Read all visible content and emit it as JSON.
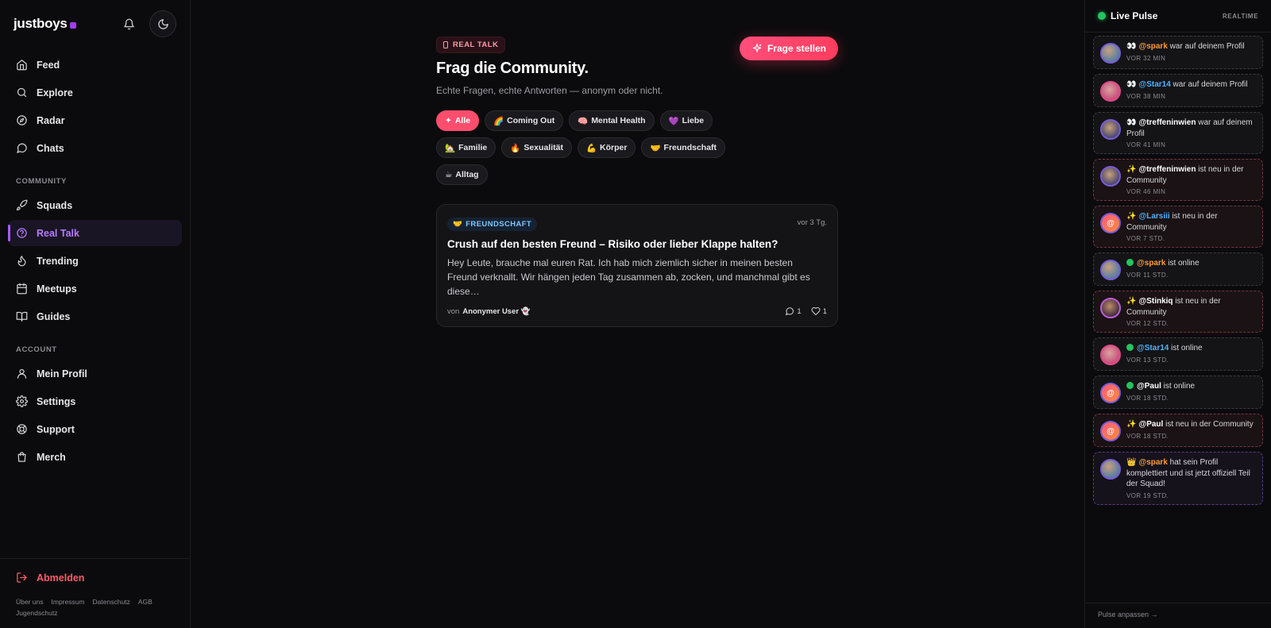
{
  "brand": {
    "name": "justboys"
  },
  "sidebar": {
    "items": [
      {
        "label": "Feed",
        "icon": "home-icon"
      },
      {
        "label": "Explore",
        "icon": "search-icon"
      },
      {
        "label": "Radar",
        "icon": "compass-icon"
      },
      {
        "label": "Chats",
        "icon": "chat-icon"
      }
    ],
    "community_label": "COMMUNITY",
    "community": [
      {
        "label": "Squads",
        "icon": "rocket-icon"
      },
      {
        "label": "Real Talk",
        "icon": "question-icon",
        "active": true
      },
      {
        "label": "Trending",
        "icon": "flame-icon"
      },
      {
        "label": "Meetups",
        "icon": "calendar-icon"
      },
      {
        "label": "Guides",
        "icon": "book-icon"
      }
    ],
    "account_label": "ACCOUNT",
    "account": [
      {
        "label": "Mein Profil",
        "icon": "user-icon"
      },
      {
        "label": "Settings",
        "icon": "gear-icon"
      },
      {
        "label": "Support",
        "icon": "lifebuoy-icon"
      },
      {
        "label": "Merch",
        "icon": "bag-icon"
      }
    ],
    "logout": "Abmelden",
    "footer_links": [
      "Über uns",
      "Impressum",
      "Datenschutz",
      "AGB",
      "Jugendschutz"
    ]
  },
  "main": {
    "tag": "REAL TALK",
    "title": "Frag die Community.",
    "subtitle": "Echte Fragen, echte Antworten — anonym oder nicht.",
    "ask_button": "Frage stellen",
    "filters": [
      {
        "emoji": "✦",
        "label": "Alle",
        "active": true
      },
      {
        "emoji": "🌈",
        "label": "Coming Out"
      },
      {
        "emoji": "🧠",
        "label": "Mental Health"
      },
      {
        "emoji": "💜",
        "label": "Liebe"
      },
      {
        "emoji": "🏡",
        "label": "Familie"
      },
      {
        "emoji": "🔥",
        "label": "Sexualität"
      },
      {
        "emoji": "💪",
        "label": "Körper"
      },
      {
        "emoji": "🤝",
        "label": "Freundschaft"
      },
      {
        "emoji": "☕",
        "label": "Alltag"
      }
    ],
    "post": {
      "category_emoji": "🤝",
      "category": "FREUNDSCHAFT",
      "time": "vor 3 Tg.",
      "title": "Crush auf den besten Freund – Risiko oder lieber Klappe halten?",
      "body": "Hey Leute, brauche mal euren Rat. Ich hab mich ziemlich sicher in meinen besten Freund verknallt. Wir hängen jeden Tag zusammen ab, zocken, und manchmal gibt es diese…",
      "author_prefix": "von",
      "author": "Anonymer User 👻",
      "comments": "1",
      "likes": "1"
    }
  },
  "pulse": {
    "title": "Live Pulse",
    "badge": "REALTIME",
    "footer": "Pulse anpassen →",
    "items": [
      {
        "emoji": "👀",
        "handle": "@spark",
        "handle_color": "#ff9a3c",
        "text": "war auf deinem Profil",
        "time": "VOR 32 MIN",
        "kind": "normal",
        "avatar": "av-a"
      },
      {
        "emoji": "👀",
        "handle": "@Star14",
        "handle_color": "#4fb2ff",
        "text": "war auf deinem Profil",
        "time": "VOR 38 MIN",
        "kind": "normal",
        "avatar": "av-b"
      },
      {
        "emoji": "👀",
        "handle": "@treffeninwien",
        "handle_color": "#ffffff",
        "text": "war auf deinem Profil",
        "time": "VOR 41 MIN",
        "kind": "normal",
        "avatar": "av-c"
      },
      {
        "emoji": "✨",
        "handle": "@treffeninwien",
        "handle_color": "#ffffff",
        "text": "ist neu in der Community",
        "time": "VOR 46 MIN",
        "kind": "new",
        "avatar": "av-c"
      },
      {
        "emoji": "✨",
        "handle": "@Larsiii",
        "handle_color": "#4fb2ff",
        "text": "ist neu in der Community",
        "time": "VOR 7 STD.",
        "kind": "new",
        "avatar": "av-at"
      },
      {
        "emoji": "●",
        "handle": "@spark",
        "handle_color": "#ff9a3c",
        "text": "ist online",
        "time": "VOR 11 STD.",
        "kind": "online",
        "avatar": "av-a"
      },
      {
        "emoji": "✨",
        "handle": "@Stinkiq",
        "handle_color": "#ffffff",
        "text": "ist neu in der Community",
        "time": "VOR 12 STD.",
        "kind": "new",
        "avatar": "av-d"
      },
      {
        "emoji": "●",
        "handle": "@Star14",
        "handle_color": "#4fb2ff",
        "text": "ist online",
        "time": "VOR 13 STD.",
        "kind": "online",
        "avatar": "av-b"
      },
      {
        "emoji": "●",
        "handle": "@Paul",
        "handle_color": "#ffffff",
        "text": "ist online",
        "time": "VOR 18 STD.",
        "kind": "online",
        "avatar": "av-at"
      },
      {
        "emoji": "✨",
        "handle": "@Paul",
        "handle_color": "#ffffff",
        "text": "ist neu in der Community",
        "time": "VOR 18 STD.",
        "kind": "new",
        "avatar": "av-at"
      },
      {
        "emoji": "👑",
        "handle": "@spark",
        "handle_color": "#ff9a3c",
        "text": "hat sein Profil komplettiert und ist jetzt offiziell Teil der Squad!",
        "time": "VOR 19 STD.",
        "kind": "big",
        "avatar": "av-a"
      }
    ]
  },
  "colors": {
    "accent": "#ff4d6d",
    "active_nav": "#b47cff",
    "online": "#22c55e",
    "logout": "#ff5a6e"
  }
}
